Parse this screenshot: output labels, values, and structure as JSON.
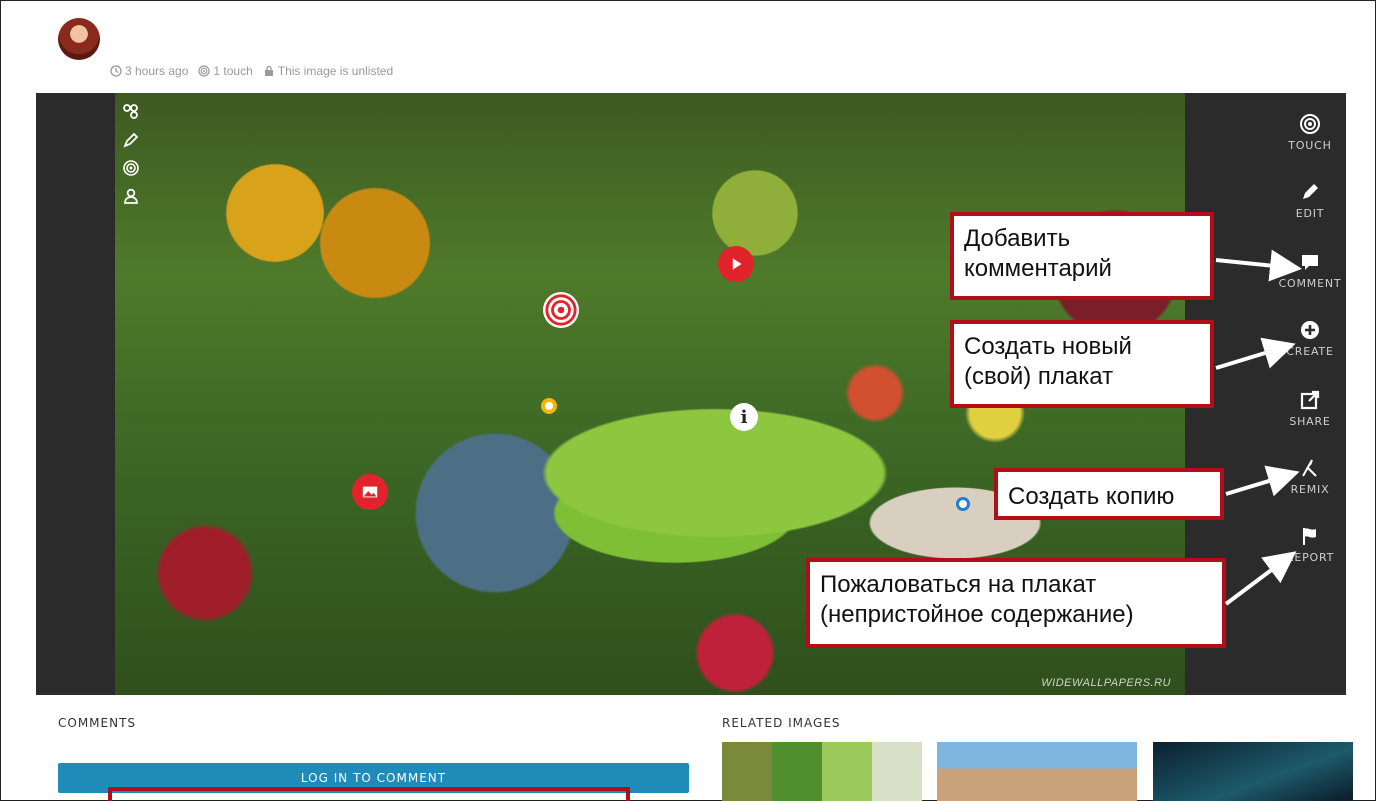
{
  "meta": {
    "time": "3 hours ago",
    "touches": "1 touch",
    "visibility": "This image is unlisted"
  },
  "image": {
    "watermark": "WIDEWALLPAPERS.RU"
  },
  "left_tools": [
    "touches-icon",
    "pencil-icon",
    "target-icon",
    "user-icon"
  ],
  "right_toolbar": {
    "touch": "TOUCH",
    "edit": "EDIT",
    "comment": "COMMENT",
    "create": "CREATE",
    "share": "SHARE",
    "remix": "REMIX",
    "report": "REPORT"
  },
  "callouts": {
    "comment": "Добавить комментарий",
    "create_line1": "Создать новый",
    "create_line2": "(свой) плакат",
    "remix": "Создать копию",
    "report_line1": "Пожаловаться на плакат",
    "report_line2": "(непристойное содержание)"
  },
  "comments": {
    "title": "COMMENTS",
    "login_label": "LOG IN TO COMMENT"
  },
  "related": {
    "title": "RELATED IMAGES"
  },
  "colors": {
    "accent_blue": "#1e8bb8",
    "hotspot_red": "#e1242b",
    "callout_border": "#b00f1a",
    "toolbar_bg": "#2b2b2b"
  }
}
